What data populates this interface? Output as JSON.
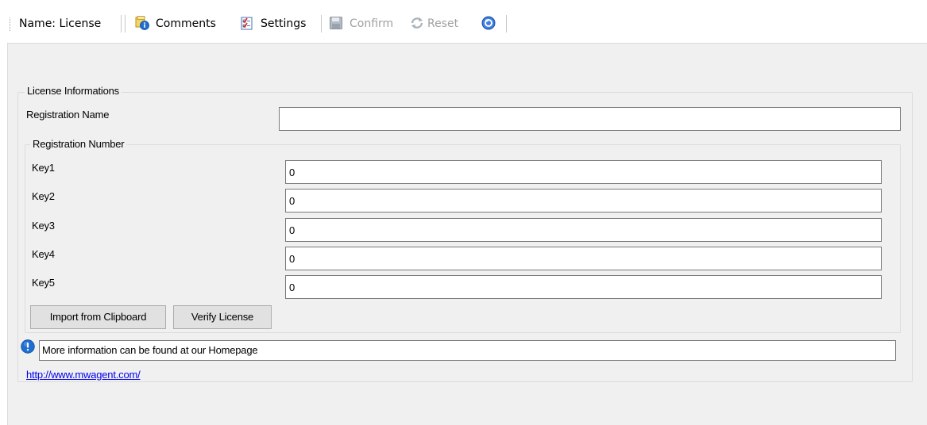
{
  "toolbar": {
    "name_label": "Name: License",
    "comments_label": "Comments",
    "settings_label": "Settings",
    "confirm_label": "Confirm",
    "reset_label": "Reset",
    "icons": [
      "comments-icon",
      "settings-icon",
      "save-icon",
      "reset-icon",
      "help-icon"
    ]
  },
  "license": {
    "group_title": "License Informations",
    "registration_name_label": "Registration Name",
    "registration_name_value": "",
    "registration_number": {
      "group_title": "Registration Number",
      "keys": [
        {
          "label": "Key1",
          "value": "0"
        },
        {
          "label": "Key2",
          "value": "0"
        },
        {
          "label": "Key3",
          "value": "0"
        },
        {
          "label": "Key4",
          "value": "0"
        },
        {
          "label": "Key5",
          "value": "0"
        }
      ],
      "import_button": "Import from Clipboard",
      "verify_button": "Verify License"
    },
    "info_text": "More information can be found at our Homepage",
    "homepage_link": "http://www.mwagent.com/"
  },
  "colors": {
    "panel_background": "#f0f0f0",
    "link": "#0000ee",
    "info_icon": "#1f6fd1"
  }
}
